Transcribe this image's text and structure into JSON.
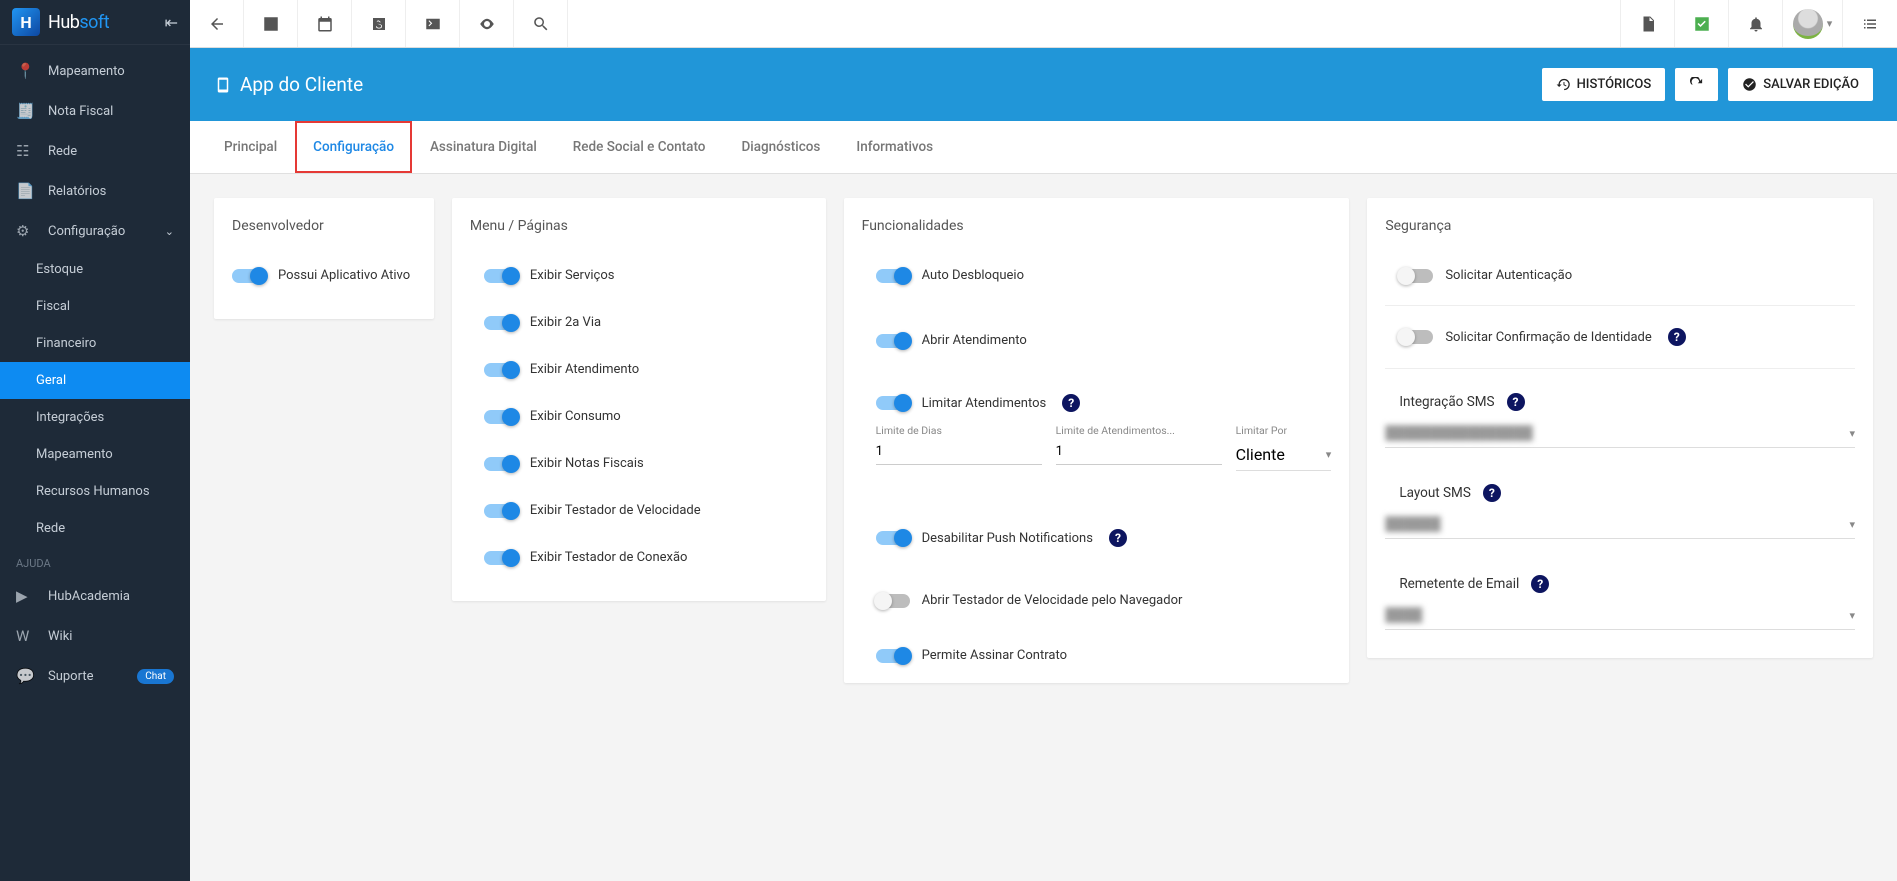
{
  "brand": {
    "name_a": "Hub",
    "name_b": "soft"
  },
  "sidebar": {
    "items": [
      {
        "label": "Mapeamento",
        "icon": "pin"
      },
      {
        "label": "Nota Fiscal",
        "icon": "doc"
      },
      {
        "label": "Rede",
        "icon": "hub"
      },
      {
        "label": "Relatórios",
        "icon": "page"
      },
      {
        "label": "Configuração",
        "icon": "gear",
        "expandable": true
      }
    ],
    "subitems": [
      {
        "label": "Estoque"
      },
      {
        "label": "Fiscal"
      },
      {
        "label": "Financeiro"
      },
      {
        "label": "Geral",
        "active": true
      },
      {
        "label": "Integrações"
      },
      {
        "label": "Mapeamento"
      },
      {
        "label": "Recursos Humanos"
      },
      {
        "label": "Rede"
      }
    ],
    "help_header": "AJUDA",
    "help": [
      {
        "label": "HubAcademia",
        "icon": "play"
      },
      {
        "label": "Wiki",
        "icon": "w"
      },
      {
        "label": "Suporte",
        "icon": "chat",
        "badge": "Chat"
      }
    ]
  },
  "header": {
    "title": "App do Cliente",
    "btn_history": "HISTÓRICOS",
    "btn_save": "SALVAR EDIÇÃO"
  },
  "tabs": [
    {
      "label": "Principal"
    },
    {
      "label": "Configuração",
      "active": true,
      "highlighted": true
    },
    {
      "label": "Assinatura Digital"
    },
    {
      "label": "Rede Social e Contato"
    },
    {
      "label": "Diagnósticos"
    },
    {
      "label": "Informativos"
    }
  ],
  "cards": {
    "dev": {
      "title": "Desenvolvedor",
      "items": [
        {
          "label": "Possui Aplicativo Ativo",
          "on": true
        }
      ]
    },
    "menu": {
      "title": "Menu / Páginas",
      "items": [
        {
          "label": "Exibir Serviços",
          "on": true
        },
        {
          "label": "Exibir 2a Via",
          "on": true
        },
        {
          "label": "Exibir Atendimento",
          "on": true
        },
        {
          "label": "Exibir Consumo",
          "on": true
        },
        {
          "label": "Exibir Notas Fiscais",
          "on": true
        },
        {
          "label": "Exibir Testador de Velocidade",
          "on": true
        },
        {
          "label": "Exibir Testador de Conexão",
          "on": true
        }
      ]
    },
    "func": {
      "title": "Funcionalidades",
      "items_top": [
        {
          "label": "Auto Desbloqueio",
          "on": true
        },
        {
          "label": "Abrir Atendimento",
          "on": true
        },
        {
          "label": "Limitar Atendimentos",
          "on": true,
          "help": true
        }
      ],
      "fields": {
        "limite_dias": {
          "label": "Limite de Dias",
          "value": "1"
        },
        "limite_atend": {
          "label": "Limite de Atendimentos...",
          "value": "1"
        },
        "limitar_por": {
          "label": "Limitar Por",
          "value": "Cliente"
        }
      },
      "items_bottom": [
        {
          "label": "Desabilitar Push Notifications",
          "on": true,
          "help": true
        },
        {
          "label": "Abrir Testador de Velocidade pelo Navegador",
          "on": false
        },
        {
          "label": "Permite Assinar Contrato",
          "on": true
        }
      ]
    },
    "sec": {
      "title": "Segurança",
      "items": [
        {
          "label": "Solicitar Autenticação",
          "on": false
        },
        {
          "label": "Solicitar Confirmação de Identidade",
          "on": false,
          "help": true
        }
      ],
      "labels": {
        "sms_integration": "Integração SMS",
        "sms_layout": "Layout SMS",
        "email_sender": "Remetente de Email"
      },
      "sms_integration_value": "████████████████",
      "sms_layout_value": "██████",
      "email_sender_value": "████"
    }
  }
}
